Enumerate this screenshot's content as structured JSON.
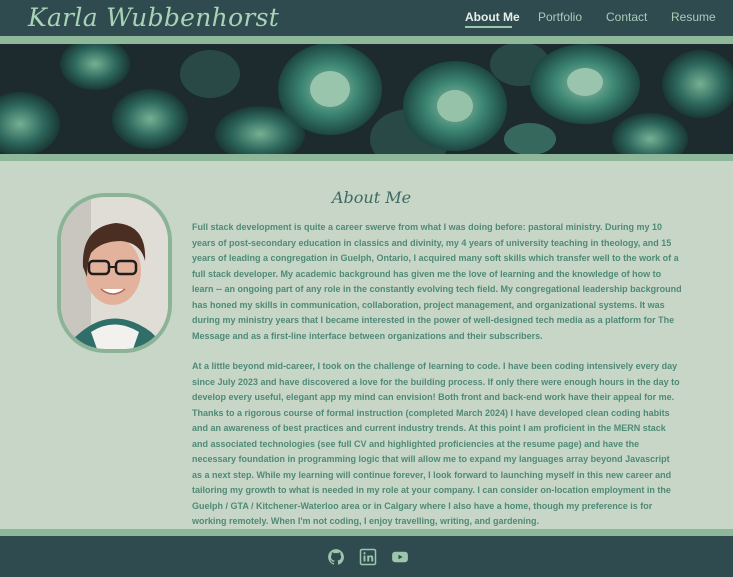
{
  "header": {
    "brand": "Karla Wubbenhorst",
    "nav": [
      {
        "label": "About Me",
        "active": true
      },
      {
        "label": "Portfolio",
        "active": false
      },
      {
        "label": "Contact",
        "active": false
      },
      {
        "label": "Resume",
        "active": false
      }
    ]
  },
  "about": {
    "title": "About Me",
    "paragraphs": [
      "Full stack development is quite a career swerve from what I was doing before: pastoral ministry. During my 10 years of post-secondary education in classics and divinity, my 4 years of university teaching in theology, and 15 years of leading a congregation in Guelph, Ontario, I acquired many soft skills which transfer well to the work of a full stack developer. My academic background has given me the love of learning and the knowledge of how to learn -- an ongoing part of any role in the constantly evolving tech field. My congregational leadership background has honed my skills in communication, collaboration, project management, and organizational systems. It was during my ministry years that I became interested in the power of well-designed tech media as a platform for The Message and as a first-line interface between organizations and their subscribers.",
      "At a little beyond mid-career, I took on the challenge of learning to code. I have been coding intensively every day since July 2023 and have discovered a love for the building process. If only there were enough hours in the day to develop every useful, elegant app my mind can envision! Both front and back-end work have their appeal for me. Thanks to a rigorous course of formal instruction (completed March 2024) I have developed clean coding habits and an awareness of best practices and current industry trends. At this point I am proficient in the MERN stack and associated technologies (see full CV and highlighted proficiencies at the resume page) and have the necessary foundation in programming logic that will allow me to expand my languages array beyond Javascript as a next step. While my learning will continue forever, I look forward to launching myself in this new career and tailoring my growth to what is needed in my role at your company. I can consider on-location employment in the Guelph / GTA / Kitchener-Waterloo area or in Calgary where I also have a home, though my preference is for working remotely. When I'm not coding, I enjoy travelling, writing, and gardening."
    ]
  },
  "footer": {
    "icons": [
      "github-icon",
      "linkedin-icon",
      "youtube-icon"
    ]
  },
  "colors": {
    "header_bg": "#2f4b50",
    "accent_green": "#8fb79a",
    "page_bg": "#c7d6c7",
    "text_green": "#4f8a77"
  }
}
